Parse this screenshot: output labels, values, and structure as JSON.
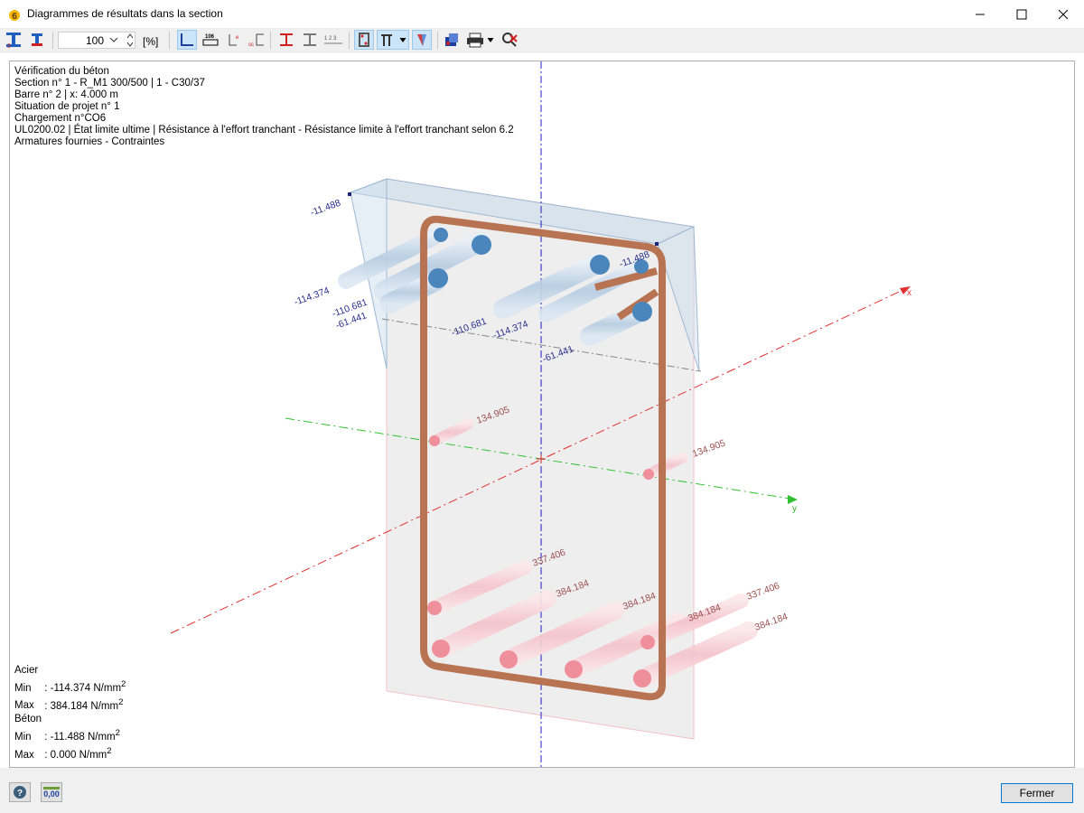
{
  "window": {
    "title": "Diagrammes de résultats dans la section"
  },
  "toolbar": {
    "zoom_value": "100",
    "zoom_unit": "[%]"
  },
  "info_lines": [
    "Vérification du béton",
    "Section n° 1 - R_M1 300/500 | 1 - C30/37",
    "Barre n° 2 | x: 4.000 m",
    "Situation de projet n° 1",
    "Chargement n°CO6",
    "UL0200.02 | État limite ultime | Résistance à l'effort tranchant - Résistance limite à l'effort tranchant selon 6.2",
    "Armatures fournies - Contraintes"
  ],
  "diagram": {
    "axis_x": "x",
    "axis_y": "y",
    "labels_compression": [
      "-11.488",
      "-114.374",
      "-110.681",
      "-61.441",
      "-110.681",
      "-114.374",
      "-61.441",
      "-11.488"
    ],
    "labels_tension": [
      "134.905",
      "134.905",
      "337.406",
      "384.184",
      "384.184",
      "384.184",
      "337.406",
      "384.184"
    ]
  },
  "summary": {
    "steel_title": "Acier",
    "concrete_title": "Béton",
    "min_label": "Min",
    "max_label": "Max",
    "sep": ":",
    "steel_min": "-114.374",
    "steel_max": "384.184",
    "concrete_min": "-11.488",
    "concrete_max": "0.000",
    "unit": "N/mm",
    "unit_exp": "2"
  },
  "buttons": {
    "close": "Fermer",
    "decimals_icon_text": "0,00"
  },
  "colors": {
    "compression_label": "#2b2f8c",
    "tension_label": "#9c5050",
    "stirrup": "#b87452",
    "x_axis": "#e03030",
    "y_axis": "#30b030",
    "z_axis": "#2020c0"
  }
}
